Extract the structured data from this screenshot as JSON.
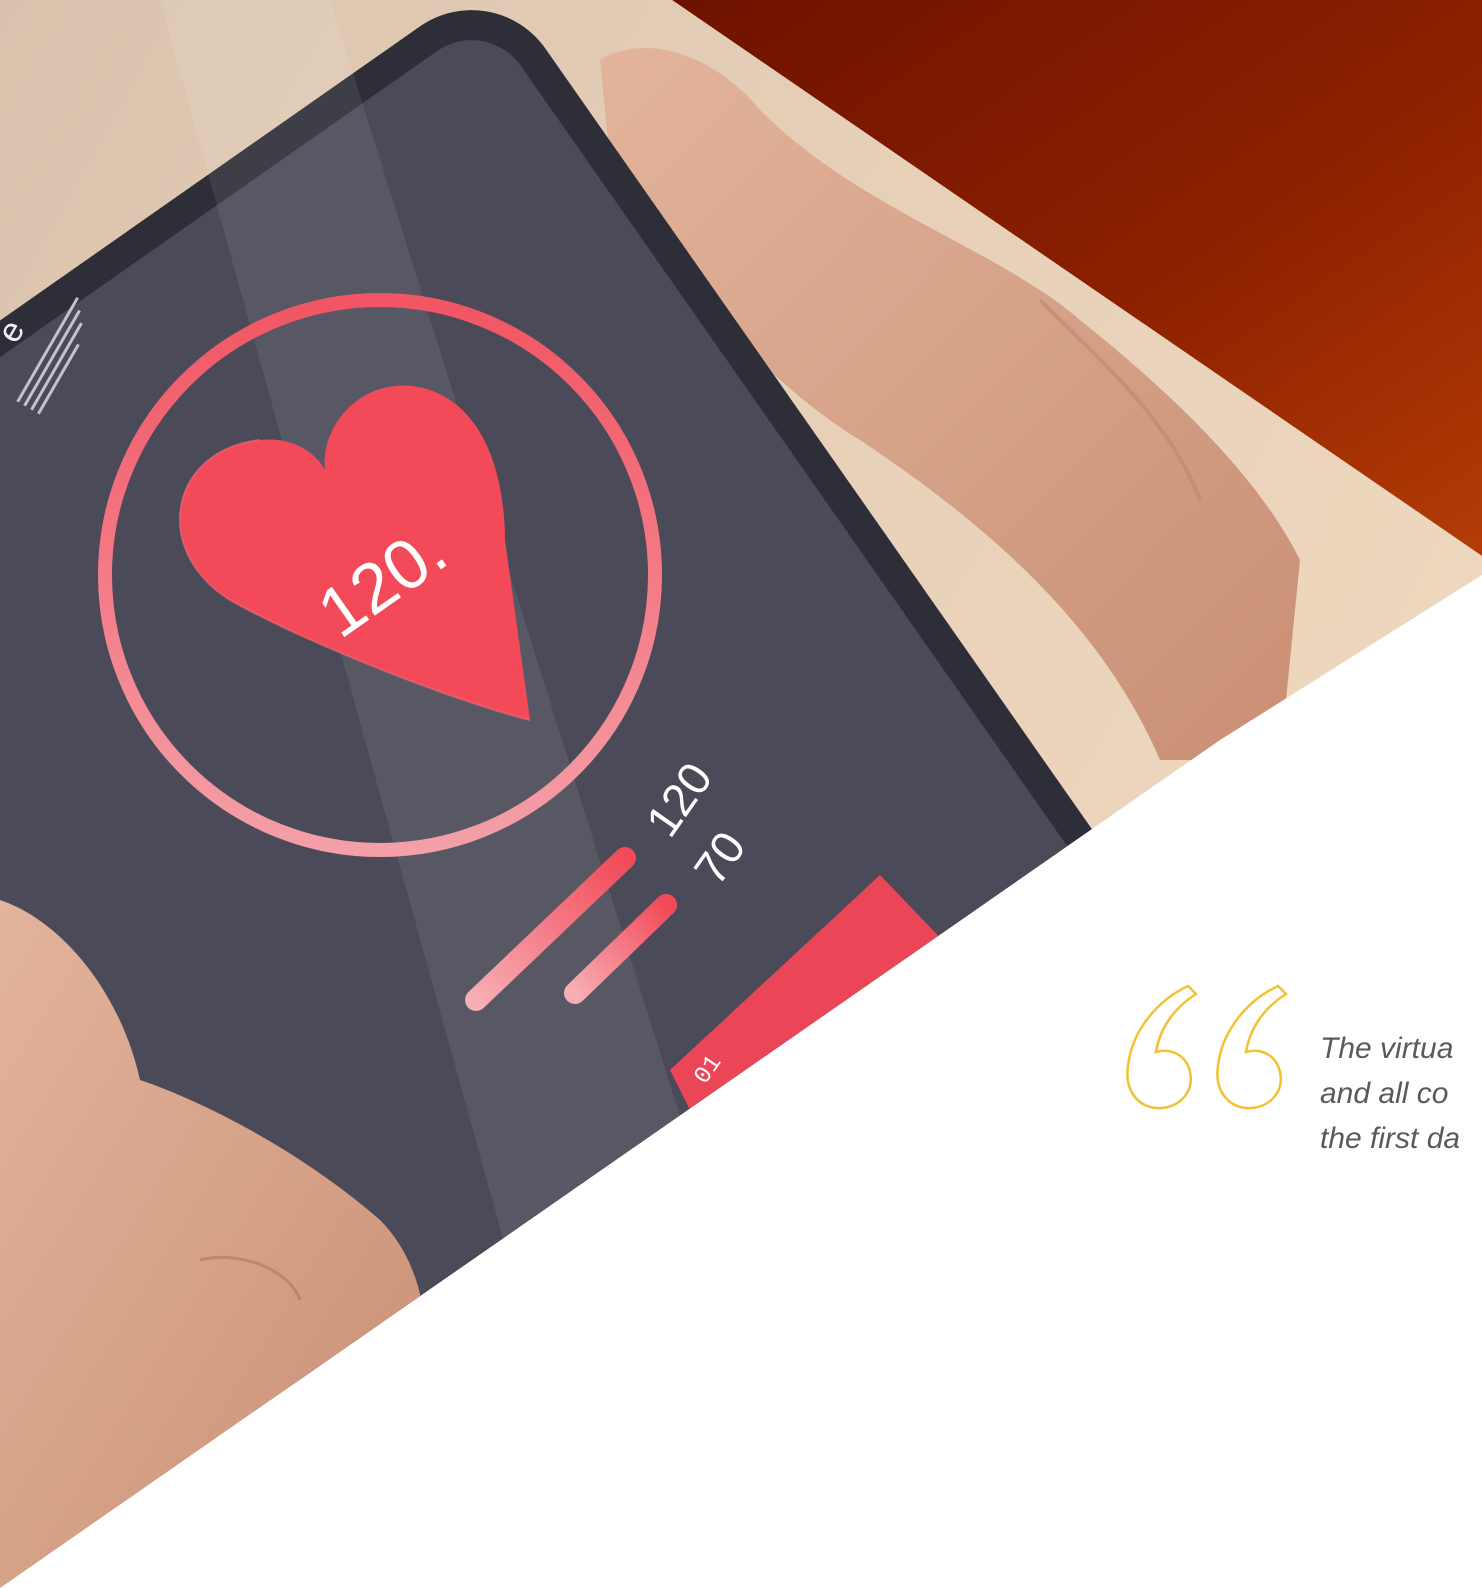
{
  "photo": {
    "heart_rate": "120.",
    "pressure_systolic": "120",
    "pressure_diastolic": "70",
    "sheet_label": "01",
    "partial_heading": "e"
  },
  "quote": {
    "lines": [
      "The virtua",
      "and all co",
      "the first da"
    ]
  },
  "colors": {
    "accent_orange_dark": "#7a1600",
    "accent_orange_light": "#b43a06",
    "quote_mark": "#f2c230",
    "quote_text": "#5a5a5a",
    "heart_red": "#f24a58",
    "phone_screen": "#4a4a58"
  }
}
